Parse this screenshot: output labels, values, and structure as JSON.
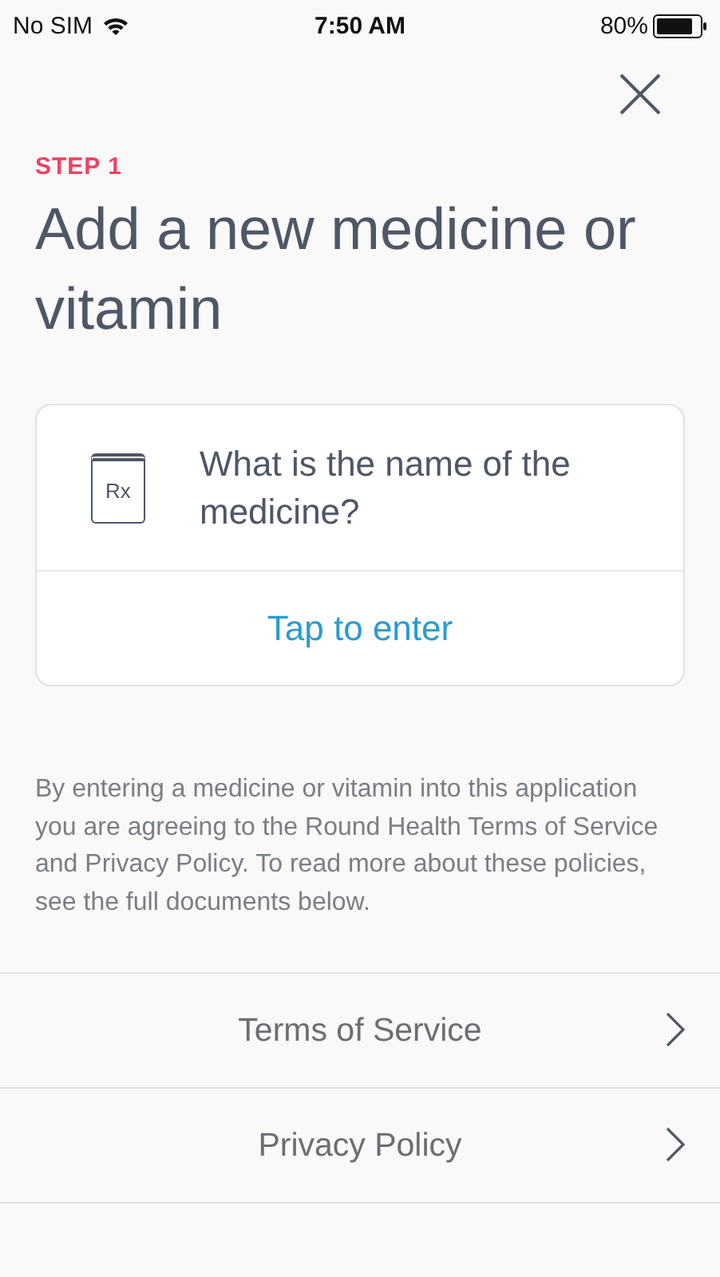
{
  "status_bar": {
    "carrier": "No SIM",
    "time": "7:50 AM",
    "battery": "80%"
  },
  "step": "STEP 1",
  "title": "Add a new medicine or vitamin",
  "card": {
    "icon_label": "Rx",
    "question": "What is the name of the medicine?",
    "action": "Tap to enter"
  },
  "disclaimer": "By entering a medicine or vitamin into this application you are agreeing to the Round Health Terms of Service and Privacy Policy. To read more about these policies, see the full documents below.",
  "links": [
    {
      "label": "Terms of Service"
    },
    {
      "label": "Privacy Policy"
    }
  ]
}
